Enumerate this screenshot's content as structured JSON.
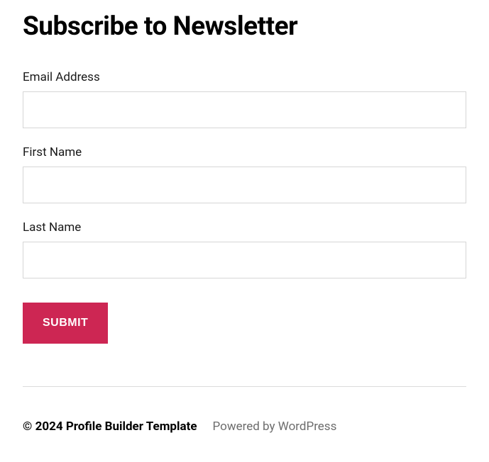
{
  "heading": "Subscribe to Newsletter",
  "form": {
    "email": {
      "label": "Email Address",
      "value": ""
    },
    "firstName": {
      "label": "First Name",
      "value": ""
    },
    "lastName": {
      "label": "Last Name",
      "value": ""
    },
    "submitLabel": "Submit"
  },
  "footer": {
    "copyright": "© 2024 Profile Builder Template",
    "poweredBy": "Powered by WordPress"
  }
}
